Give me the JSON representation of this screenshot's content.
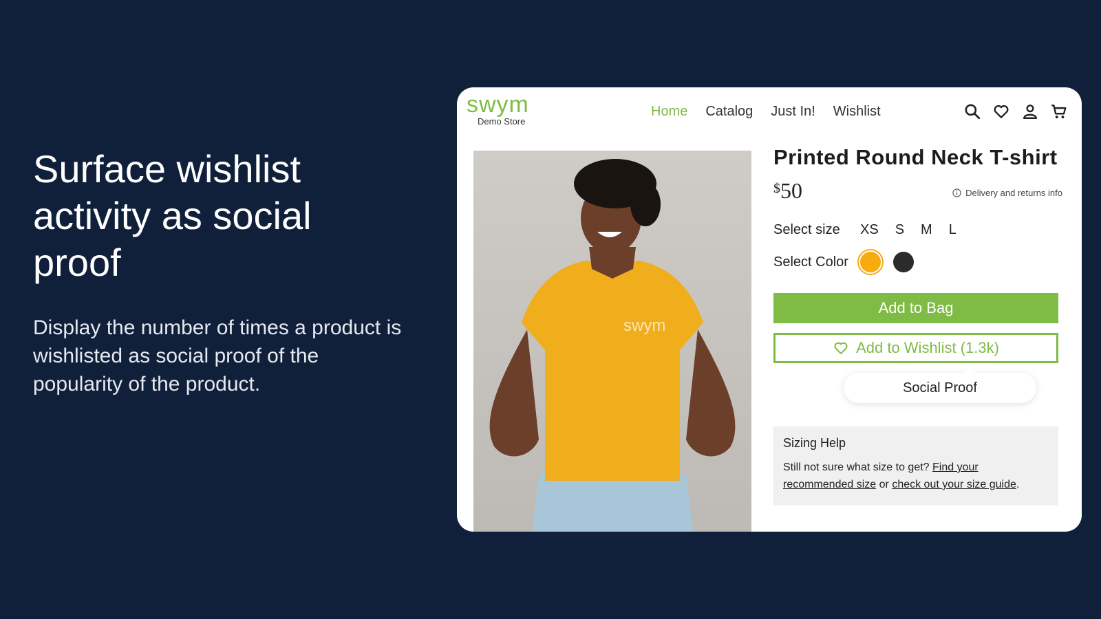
{
  "hero": {
    "title": "Surface wishlist activity as social proof",
    "description": "Display the number of times a product is wishlisted as social proof of the popularity of the product."
  },
  "store": {
    "logo": "swym",
    "logo_sub": "Demo Store",
    "nav": [
      "Home",
      "Catalog",
      "Just In!",
      "Wishlist"
    ],
    "active_nav": "Home",
    "icons": [
      "search-icon",
      "heart-icon",
      "user-icon",
      "cart-icon"
    ]
  },
  "product": {
    "title": "Printed Round Neck T-shirt",
    "price_currency": "$",
    "price_amount": "50",
    "delivery_info": "Delivery and returns info",
    "size_label": "Select size",
    "sizes": [
      "XS",
      "S",
      "M",
      "L"
    ],
    "color_label": "Select Color",
    "colors": [
      "#f6ab0f",
      "#2b2b2b"
    ],
    "add_to_bag": "Add to Bag",
    "add_to_wishlist": "Add to Wishlist (1.3k)",
    "social_proof": "Social Proof",
    "shirt_print": "swym"
  },
  "sizing_help": {
    "title": "Sizing Help",
    "text_prefix": "Still not sure what size to get?",
    "link_recommended": "Find your recommended size",
    "text_or": "or",
    "link_guide": "check out your size guide",
    "text_end": "."
  },
  "colors": {
    "brand": "#7ebc45",
    "background": "#11203a"
  }
}
